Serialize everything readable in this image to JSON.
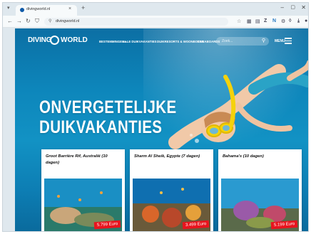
{
  "browser": {
    "tab_title": "divingworld.nl",
    "url": "divingworld.nl",
    "new_tab_label": "+",
    "tab_close_label": "×"
  },
  "site": {
    "logo_left": "DIVING",
    "logo_right": "WORLD",
    "nav": [
      "BESTEMMINGEN ▾",
      "ALLE DUIKVAKANTIES",
      "DUIKRESORTS & WOONBOTEN",
      "LIVEABOARDS"
    ],
    "search_placeholder": "Zoek...",
    "menu_label": "MENU"
  },
  "hero": {
    "line1": "ONVERGETELIJKE",
    "line2": "DUIKVAKANTIES"
  },
  "cards": [
    {
      "title": "Groot Barrière Rif, Australië (10 dagen)",
      "price": "5.799 Euro"
    },
    {
      "title": "Sharm Al Sheik, Egypte (7 dagen)",
      "price": "3.499 Euro"
    },
    {
      "title": "Bahama's (10 dagen)",
      "price": "5.199 Euro"
    }
  ],
  "colors": {
    "ocean": "#0d86bb",
    "price_badge": "#e8141e",
    "mask": "#f5d20a"
  }
}
